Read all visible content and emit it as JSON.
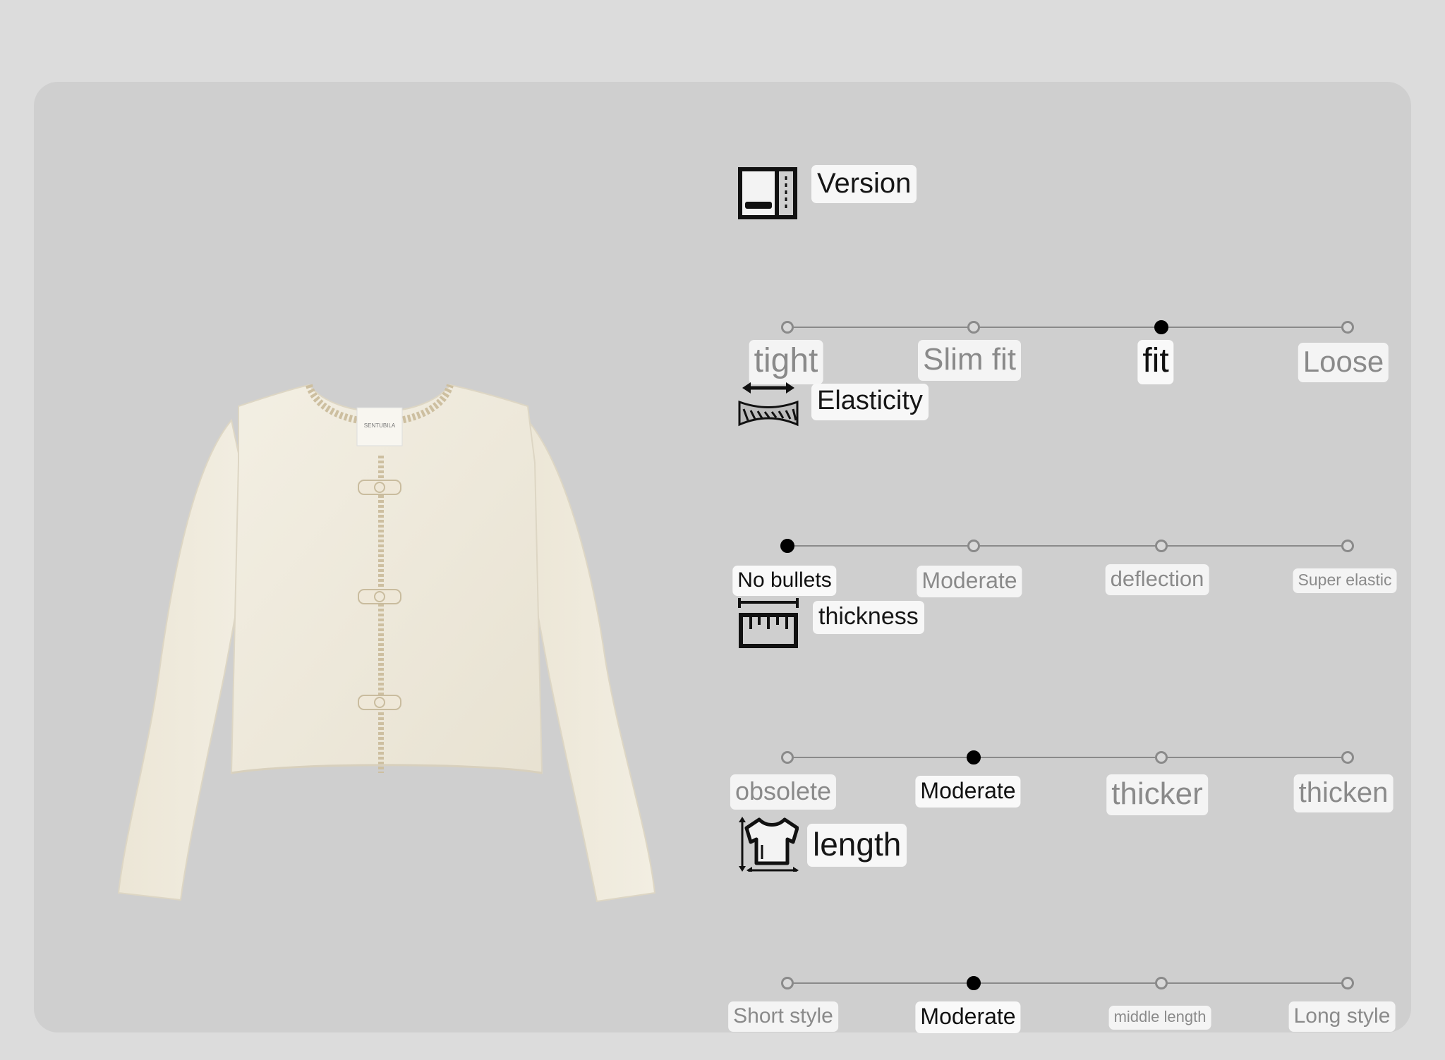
{
  "jacket": {
    "label_text": "SENTUBILA"
  },
  "sections": [
    {
      "title": "Version",
      "icon": "wardrobe-icon",
      "selected_index": 2,
      "options": [
        "tight",
        "Slim fit",
        "fit",
        "Loose"
      ]
    },
    {
      "title": "Elasticity",
      "icon": "stretch-fabric-icon",
      "selected_index": 0,
      "options": [
        "No bullets",
        "Moderate",
        "deflection",
        "Super elastic"
      ]
    },
    {
      "title": "thickness",
      "icon": "ruler-icon",
      "selected_index": 1,
      "options": [
        "obsolete",
        "Moderate",
        "thicker",
        "thicken"
      ]
    },
    {
      "title": "length",
      "icon": "garment-length-icon",
      "selected_index": 1,
      "options": [
        "Short style",
        "Moderate",
        "middle length",
        "Long style"
      ]
    }
  ],
  "colors": {
    "page_background": "#dcdcdc",
    "card_background": "#cfcfcf",
    "label_background": "#f4f4f4",
    "unselected_text": "#8a8a8a",
    "selected_text": "#111111",
    "track": "#8a8a8a",
    "selected_dot": "#000000"
  }
}
